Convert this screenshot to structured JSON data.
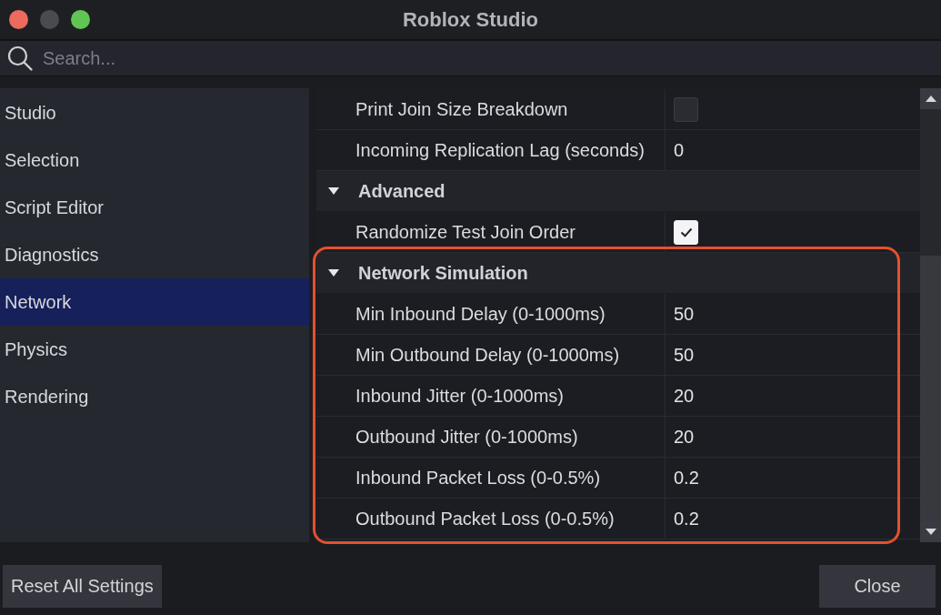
{
  "window": {
    "title": "Roblox Studio",
    "controls": [
      {
        "kind": "close",
        "disabled": false
      },
      {
        "kind": "minimize",
        "disabled": true
      },
      {
        "kind": "zoom",
        "disabled": false
      }
    ]
  },
  "search": {
    "placeholder": "Search..."
  },
  "sidebar": {
    "items": [
      {
        "label": "Studio",
        "selected": false
      },
      {
        "label": "Selection",
        "selected": false
      },
      {
        "label": "Script Editor",
        "selected": false
      },
      {
        "label": "Diagnostics",
        "selected": false
      },
      {
        "label": "Network",
        "selected": true
      },
      {
        "label": "Physics",
        "selected": false
      },
      {
        "label": "Rendering",
        "selected": false
      }
    ]
  },
  "settings": {
    "rows": [
      {
        "kind": "checkbox",
        "label": "Print Join Size Breakdown",
        "checked": false
      },
      {
        "kind": "text",
        "label": "Incoming Replication Lag (seconds)",
        "value": "0"
      }
    ],
    "sections": [
      {
        "title": "Advanced",
        "expanded": true,
        "highlighted": false,
        "rows": [
          {
            "kind": "checkbox",
            "label": "Randomize Test Join Order",
            "checked": true
          }
        ]
      },
      {
        "title": "Network Simulation",
        "expanded": true,
        "highlighted": true,
        "rows": [
          {
            "kind": "text",
            "label": "Min Inbound Delay (0-1000ms)",
            "value": "50"
          },
          {
            "kind": "text",
            "label": "Min Outbound Delay (0-1000ms)",
            "value": "50"
          },
          {
            "kind": "text",
            "label": "Inbound Jitter (0-1000ms)",
            "value": "20"
          },
          {
            "kind": "text",
            "label": "Outbound Jitter (0-1000ms)",
            "value": "20"
          },
          {
            "kind": "text",
            "label": "Inbound Packet Loss (0-0.5%)",
            "value": "0.2"
          },
          {
            "kind": "text",
            "label": "Outbound Packet Loss (0-0.5%)",
            "value": "0.2"
          }
        ]
      }
    ]
  },
  "buttons": [
    {
      "label": "Reset All Settings"
    },
    {
      "label": "Close"
    }
  ]
}
